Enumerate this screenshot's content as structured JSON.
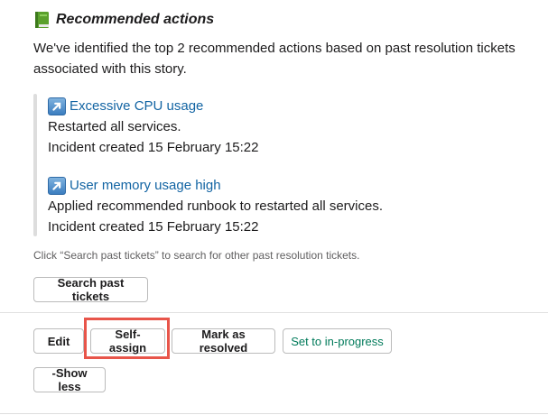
{
  "header": {
    "icon": "green-book-icon",
    "title": "Recommended actions"
  },
  "description": "We've identified the top 2 recommended actions based on past resolution tickets associated with this story.",
  "recommendations": [
    {
      "icon": "arrow-up-right-icon",
      "title": "Excessive CPU usage",
      "detail": "Restarted all services.",
      "created": "Incident created 15 February 15:22"
    },
    {
      "icon": "arrow-up-right-icon",
      "title": "User memory usage high",
      "detail": "Applied recommended runbook to restarted all services.",
      "created": "Incident created 15 February 15:22"
    }
  ],
  "hint": "Click “Search past tickets” to search for other past resolution tickets.",
  "search_button": "Search past tickets",
  "actions": {
    "edit": "Edit",
    "self_assign": "Self-assign",
    "mark_resolved": "Mark as resolved",
    "set_in_progress": "Set to in-progress"
  },
  "show_less": "-Show less",
  "colors": {
    "link": "#1264a3",
    "green": "#007a5a",
    "highlight": "#e8554a"
  }
}
